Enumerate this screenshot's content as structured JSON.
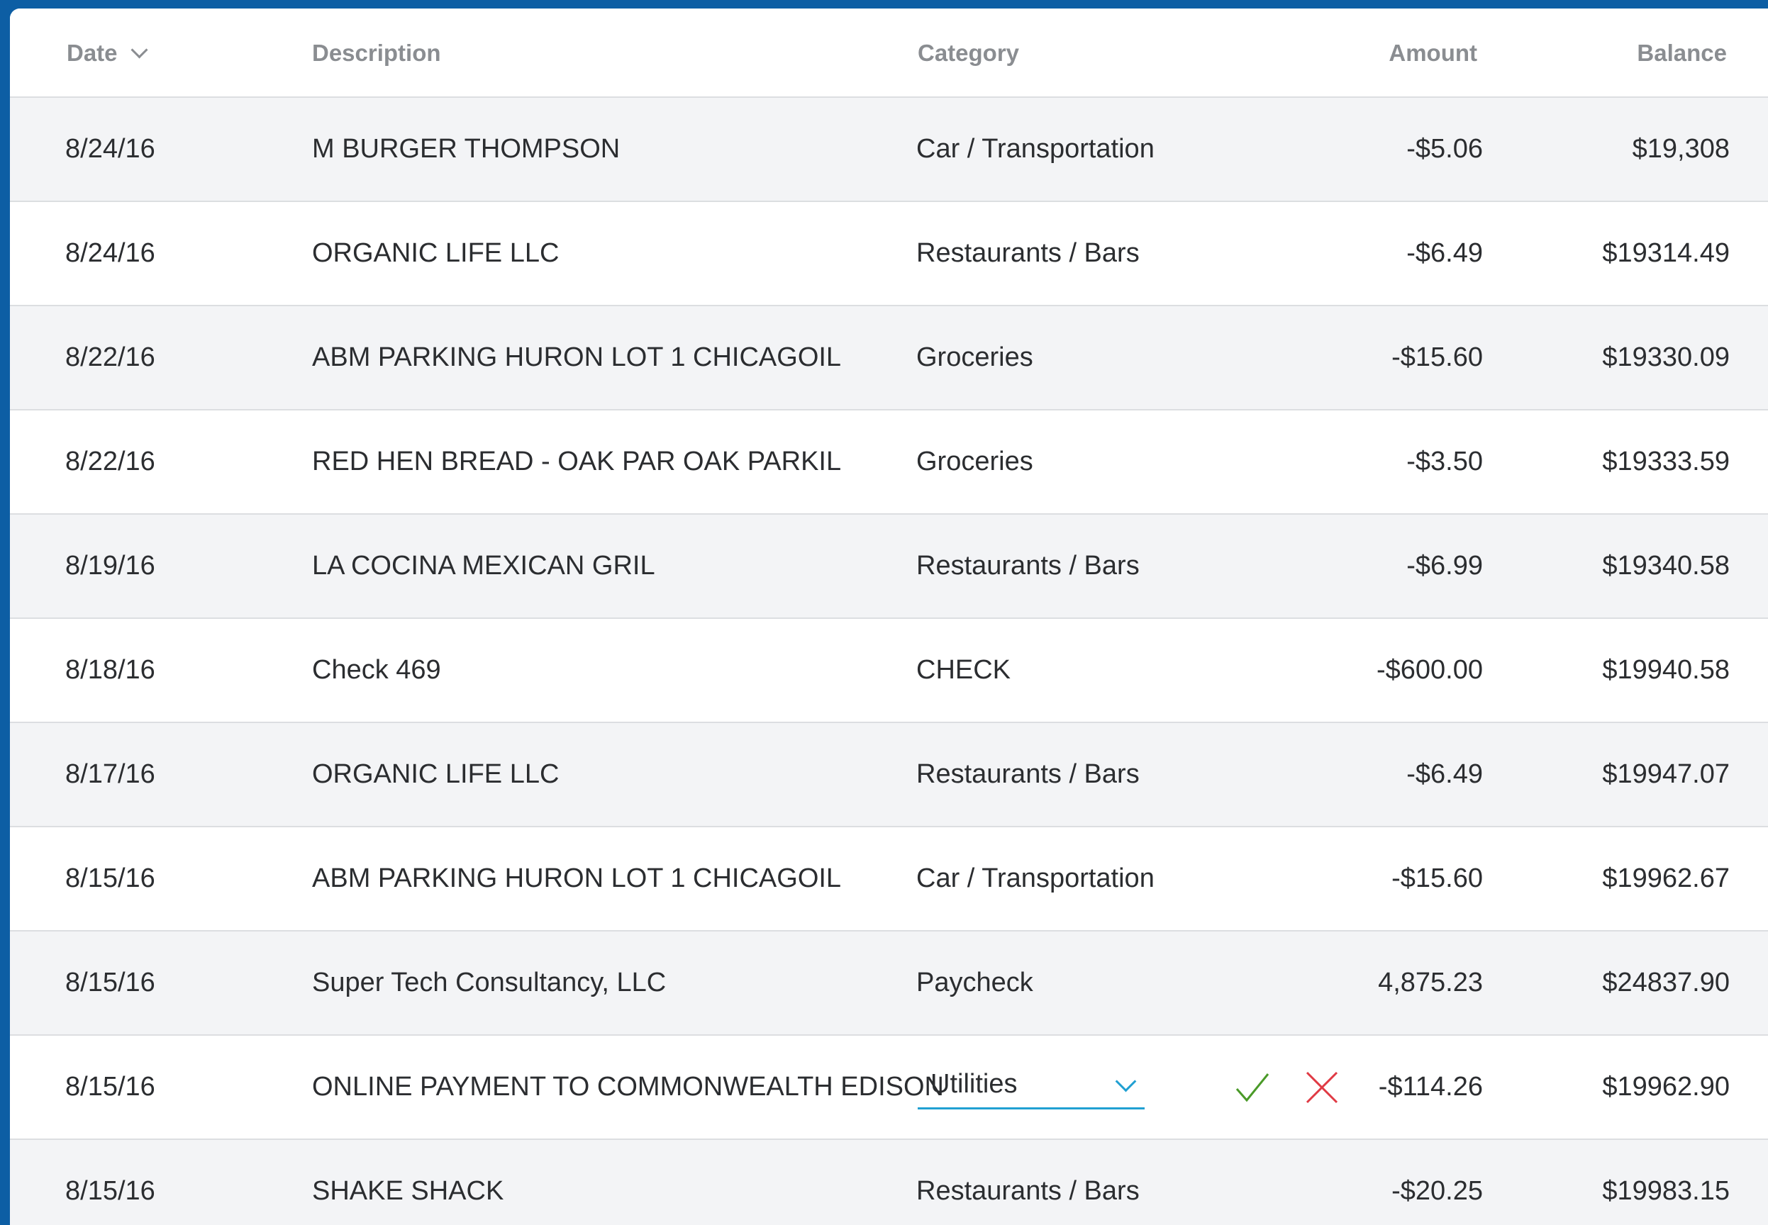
{
  "table": {
    "columns": {
      "date": "Date",
      "description": "Description",
      "category": "Category",
      "amount": "Amount",
      "balance": "Balance"
    },
    "sort": {
      "column": "date",
      "icon": "chevron-down-icon"
    },
    "rows": [
      {
        "date": "8/24/16",
        "description": "M BURGER THOMPSON",
        "category": "Car / Transportation",
        "amount": "-$5.06",
        "balance": "$19,308"
      },
      {
        "date": "8/24/16",
        "description": "ORGANIC LIFE LLC",
        "category": "Restaurants / Bars",
        "amount": "-$6.49",
        "balance": "$19314.49"
      },
      {
        "date": "8/22/16",
        "description": "ABM PARKING HURON LOT 1 CHICAGOIL",
        "category": "Groceries",
        "amount": "-$15.60",
        "balance": "$19330.09"
      },
      {
        "date": "8/22/16",
        "description": "RED HEN BREAD - OAK PAR OAK PARKIL",
        "category": "Groceries",
        "amount": "-$3.50",
        "balance": "$19333.59"
      },
      {
        "date": "8/19/16",
        "description": "LA COCINA MEXICAN GRIL",
        "category": "Restaurants / Bars",
        "amount": "-$6.99",
        "balance": "$19340.58"
      },
      {
        "date": "8/18/16",
        "description": "Check 469",
        "category": "CHECK",
        "amount": "-$600.00",
        "balance": "$19940.58"
      },
      {
        "date": "8/17/16",
        "description": "ORGANIC LIFE LLC",
        "category": "Restaurants / Bars",
        "amount": "-$6.49",
        "balance": "$19947.07"
      },
      {
        "date": "8/15/16",
        "description": "ABM PARKING HURON LOT 1 CHICAGOIL",
        "category": "Car / Transportation",
        "amount": "-$15.60",
        "balance": "$19962.67"
      },
      {
        "date": "8/15/16",
        "description": "Super Tech Consultancy, LLC",
        "category": "Paycheck",
        "amount": "4,875.23",
        "balance": "$24837.90"
      },
      {
        "date": "8/15/16",
        "description": "ONLINE PAYMENT TO COMMONWEALTH EDISON",
        "category": "Utilities",
        "amount": "-$114.26",
        "balance": "$19962.90",
        "editing": true
      },
      {
        "date": "8/15/16",
        "description": "SHAKE SHACK",
        "category": "Restaurants / Bars",
        "amount": "-$20.25",
        "balance": "$19983.15"
      }
    ]
  },
  "editor": {
    "dropdown_icon": "chevron-down-icon",
    "confirm_icon": "checkmark-icon",
    "cancel_icon": "close-icon"
  },
  "colors": {
    "background_frame": "#0d5ea4",
    "header_text": "#8a8d91",
    "row_text": "#2b2d30",
    "row_alt": "#f3f4f6",
    "accent": "#21a0d2",
    "confirm": "#4a9a28",
    "cancel": "#e03a44"
  }
}
